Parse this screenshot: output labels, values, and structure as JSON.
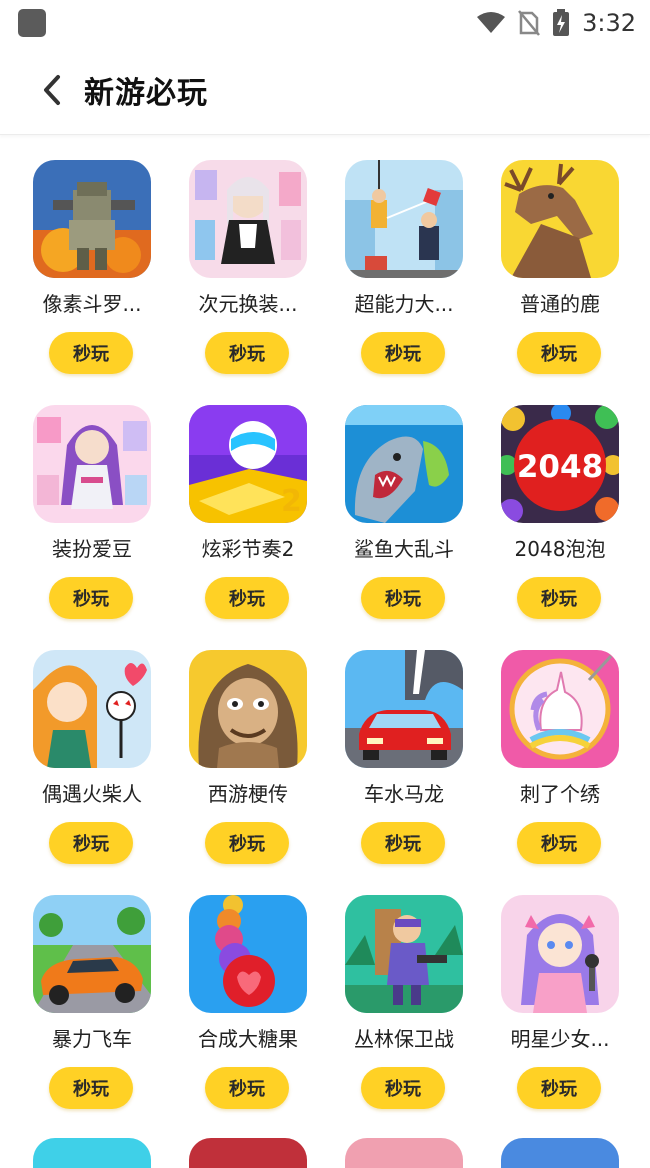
{
  "status_bar": {
    "time": "3:32"
  },
  "header": {
    "title": "新游必玩"
  },
  "play_label": "秒玩",
  "games": [
    {
      "name": "像素斗罗...",
      "icon": "pixel-soldier-icon"
    },
    {
      "name": "次元换装...",
      "icon": "anime-dressup-icon"
    },
    {
      "name": "超能力大...",
      "icon": "superpower-icon"
    },
    {
      "name": "普通的鹿",
      "icon": "deer-icon"
    },
    {
      "name": "装扮爱豆",
      "icon": "idol-dressup-icon"
    },
    {
      "name": "炫彩节奏2",
      "icon": "color-rhythm-icon"
    },
    {
      "name": "鲨鱼大乱斗",
      "icon": "shark-icon"
    },
    {
      "name": "2048泡泡",
      "icon": "bubble-2048-icon"
    },
    {
      "name": "偶遇火柴人",
      "icon": "stickman-icon"
    },
    {
      "name": "西游梗传",
      "icon": "monkey-king-icon"
    },
    {
      "name": "车水马龙",
      "icon": "car-road-icon"
    },
    {
      "name": "刺了个绣",
      "icon": "unicorn-embroidery-icon"
    },
    {
      "name": "暴力飞车",
      "icon": "racing-car-icon"
    },
    {
      "name": "合成大糖果",
      "icon": "candy-merge-icon"
    },
    {
      "name": "丛林保卫战",
      "icon": "jungle-defense-icon"
    },
    {
      "name": "明星少女...",
      "icon": "star-girl-icon"
    }
  ]
}
